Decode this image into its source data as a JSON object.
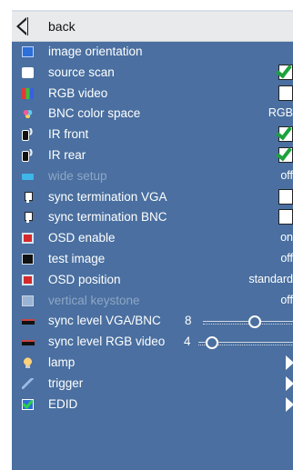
{
  "menu": {
    "back_label": "back",
    "items": [
      {
        "label": "image orientation",
        "icon": "image-orientation-icon"
      },
      {
        "label": "source scan",
        "icon": "source-scan-icon",
        "checked": true
      },
      {
        "label": "RGB video",
        "icon": "rgb-video-icon",
        "checked": false
      },
      {
        "label": "BNC color space",
        "icon": "bnc-color-space-icon",
        "value": "RGB"
      },
      {
        "label": "IR front",
        "icon": "ir-front-icon",
        "checked": true
      },
      {
        "label": "IR rear",
        "icon": "ir-rear-icon",
        "checked": true
      },
      {
        "label": "wide setup",
        "icon": "wide-setup-icon",
        "value": "off",
        "disabled": true
      },
      {
        "label": "sync termination VGA",
        "icon": "sync-termination-vga-icon",
        "checked": false
      },
      {
        "label": "sync termination BNC",
        "icon": "sync-termination-bnc-icon",
        "checked": false
      },
      {
        "label": "OSD enable",
        "icon": "osd-enable-icon",
        "value": "on"
      },
      {
        "label": "test image",
        "icon": "test-image-icon",
        "value": "off"
      },
      {
        "label": "OSD position",
        "icon": "osd-position-icon",
        "value": "standard"
      },
      {
        "label": "vertical keystone",
        "icon": "vertical-keystone-icon",
        "value": "off",
        "disabled": true
      },
      {
        "label": "sync level VGA/BNC",
        "icon": "sync-level-vga-bnc-icon",
        "slider_value": "8"
      },
      {
        "label": "sync level RGB video",
        "icon": "sync-level-rgb-video-icon",
        "slider_value": "4"
      },
      {
        "label": "lamp",
        "icon": "lamp-icon"
      },
      {
        "label": "trigger",
        "icon": "trigger-icon"
      },
      {
        "label": "EDID",
        "icon": "edid-icon"
      }
    ]
  },
  "colors": {
    "panel_bg": "#4a6fa0",
    "check_green": "#1ba23a",
    "disabled_text": "#8ea7c6"
  }
}
